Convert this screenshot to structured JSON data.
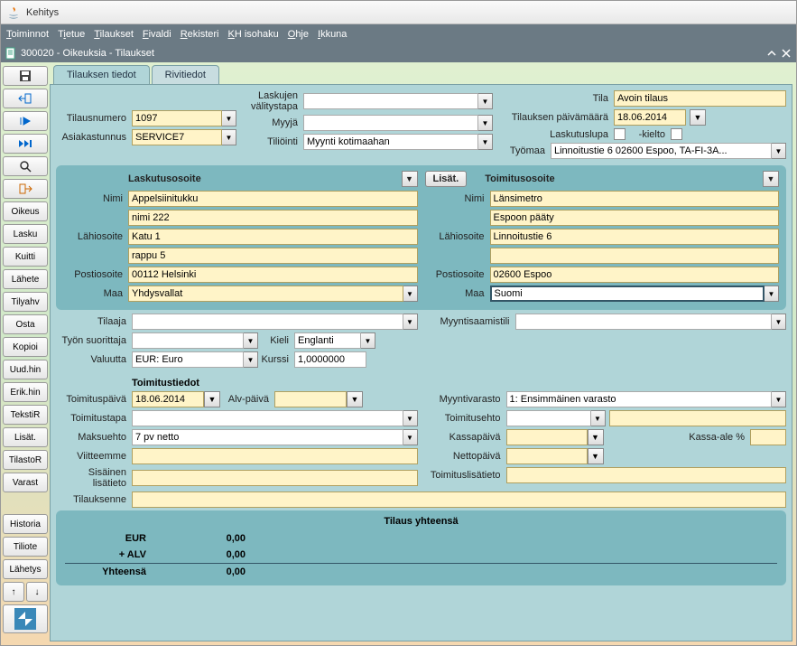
{
  "window_title": "Kehitys",
  "menu": [
    "Toiminnot",
    "Tietue",
    "Tilaukset",
    "Fivaldi",
    "Rekisteri",
    "KH isohaku",
    "Ohje",
    "Ikkuna"
  ],
  "subwin_title": "300020 - Oikeuksia - Tilaukset",
  "tabs": {
    "active": "Tilauksen tiedot",
    "other": "Rivitiedot"
  },
  "top": {
    "tilausnumero_lbl": "Tilausnumero",
    "tilausnumero": "1097",
    "asiakastunnus_lbl": "Asiakastunnus",
    "asiakastunnus": "SERVICE7",
    "laskujen_lbl": "Laskujen välitystapa",
    "myyja_lbl": "Myyjä",
    "tiliointi_lbl": "Tiliöinti",
    "tiliointi": "Myynti kotimaahan",
    "tila_lbl": "Tila",
    "tila": "Avoin tilaus",
    "pvm_lbl": "Tilauksen päivämäärä",
    "pvm": "18.06.2014",
    "laskutuslupa_lbl": "Laskutuslupa",
    "kielto_lbl": "-kielto",
    "tyomaa_lbl": "Työmaa",
    "tyomaa": "Linnoitustie 6 02600 Espoo, TA-FI-3A..."
  },
  "billing": {
    "title": "Laskutusosoite",
    "nimi_lbl": "Nimi",
    "nimi1": "Appelsiinitukku",
    "nimi2": "nimi 222",
    "lahi_lbl": "Lähiosoite",
    "lahi1": "Katu 1",
    "lahi2": "rappu 5",
    "posti_lbl": "Postiosoite",
    "posti": "00112  Helsinki",
    "maa_lbl": "Maa",
    "maa": "Yhdysvallat"
  },
  "delivery_addr": {
    "title": "Toimitusosoite",
    "lisat_btn": "Lisät.",
    "nimi_lbl": "Nimi",
    "nimi1": "Länsimetro",
    "nimi2": "Espoon pääty",
    "lahi_lbl": "Lähiosoite",
    "lahi1": "Linnoitustie 6",
    "posti_lbl": "Postiosoite",
    "posti": "02600 Espoo",
    "maa_lbl": "Maa",
    "maa": "Suomi"
  },
  "mid": {
    "tilaaja_lbl": "Tilaaja",
    "tyon_lbl": "Työn suorittaja",
    "valuutta_lbl": "Valuutta",
    "valuutta": "EUR: Euro",
    "kieli_lbl": "Kieli",
    "kieli": "Englanti",
    "kurssi_lbl": "Kurssi",
    "kurssi": "1,0000000",
    "myyntisaamistili_lbl": "Myyntisaamistili"
  },
  "delivery": {
    "title": "Toimitustiedot",
    "toimituspaiva_lbl": "Toimituspäivä",
    "toimituspaiva": "18.06.2014",
    "alvpaiva_lbl": "Alv-päivä",
    "toimitustapa_lbl": "Toimitustapa",
    "maksuehto_lbl": "Maksuehto",
    "maksuehto": "7 pv netto",
    "viitteemme_lbl": "Viitteemme",
    "sisainen_lbl": "Sisäinen lisätieto",
    "tilauksenne_lbl": "Tilauksenne",
    "myyntivarasto_lbl": "Myyntivarasto",
    "myyntivarasto": "1: Ensimmäinen varasto",
    "toimitusehto_lbl": "Toimitusehto",
    "kassapaiva_lbl": "Kassapäivä",
    "kassa_ale_lbl": "Kassa-ale %",
    "nettopaiva_lbl": "Nettopäivä",
    "toimituslisatieto_lbl": "Toimituslisätieto"
  },
  "totals": {
    "title": "Tilaus yhteensä",
    "eur_lbl": "EUR",
    "eur": "0,00",
    "alv_lbl": "+ ALV",
    "alv": "0,00",
    "yht_lbl": "Yhteensä",
    "yht": "0,00"
  },
  "side": {
    "oikeus": "Oikeus",
    "lasku": "Lasku",
    "kuitti": "Kuitti",
    "lahete": "Lähete",
    "tilyahv": "Tilyahv",
    "osta": "Osta",
    "kopioi": "Kopioi",
    "uudhin": "Uud.hin",
    "erikhin": "Erik.hin",
    "tekstir": "TekstiR",
    "lisat": "Lisät.",
    "tilastor": "TilastoR",
    "varast": "Varast",
    "historia": "Historia",
    "tiliote": "Tiliote",
    "lahetys": "Lähetys"
  }
}
